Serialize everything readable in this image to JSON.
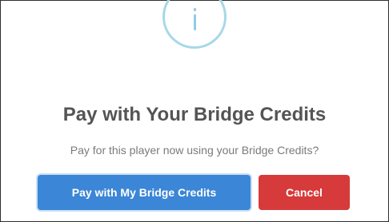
{
  "dialog": {
    "icon": "info-icon",
    "title": "Pay with Your Bridge Credits",
    "message": "Pay for this player now using your Bridge Credits?",
    "confirm_label": "Pay with My Bridge Credits",
    "cancel_label": "Cancel"
  },
  "colors": {
    "icon_ring": "#a6d8e8",
    "confirm_button": "#3b86d6",
    "cancel_button": "#d63a3a",
    "title_text": "#545454",
    "message_text": "#7a7a7a"
  }
}
